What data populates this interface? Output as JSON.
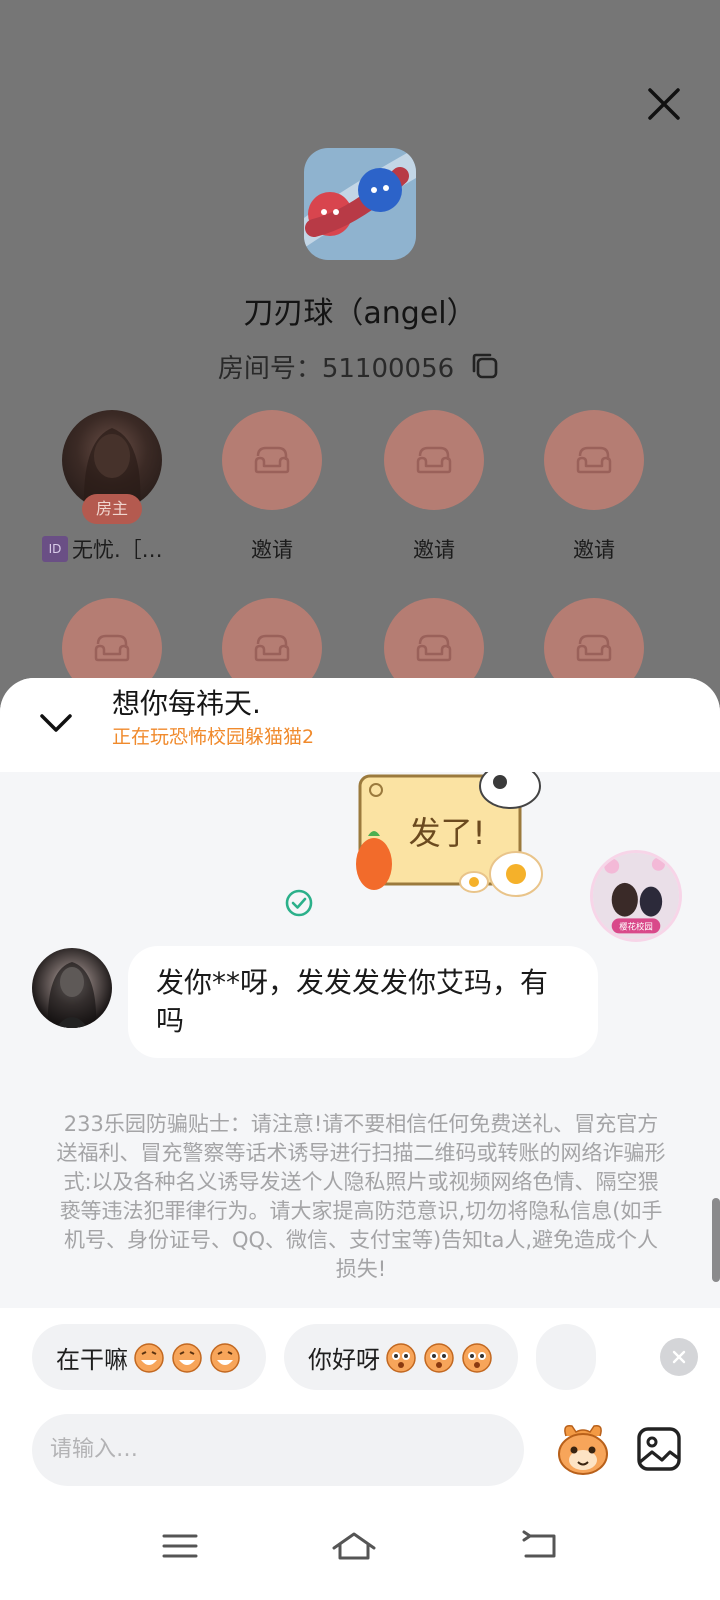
{
  "room": {
    "game_title": "刀刃球（angel）",
    "room_label": "房间号：51100056",
    "host": {
      "badge": "房主",
      "name_prefix": "ID",
      "name": "无忧.［…"
    },
    "invite_label": "邀请"
  },
  "chat": {
    "title": "想你每祎天.",
    "status": "正在玩恐怖校园躲猫猫2",
    "sticker_text": "发了!",
    "my_avatar_caption": "樱花校园",
    "message": "发你**呀，发发发发你艾玛，有吗",
    "tips": "233乐园防骗贴士：请注意!请不要相信任何免费送礼、冒充官方送福利、冒充警察等话术诱导进行扫描二维码或转账的网络诈骗形式:以及各种名义诱导发送个人隐私照片或视频网络色情、隔空猥亵等违法犯罪律行为。请大家提高防范意识,切勿将隐私信息(如手机号、身份证号、QQ、微信、支付宝等)告知ta人,避免造成个人损失!"
  },
  "quick_replies": [
    {
      "text": "在干嘛",
      "emoji": "laughing-face"
    },
    {
      "text": "你好呀",
      "emoji": "surprised-face"
    }
  ],
  "input": {
    "placeholder": "请输入…"
  },
  "colors": {
    "accent_orange": "#f08a2c",
    "seat_placeholder": "#b57d73",
    "read_check": "#2bb08a"
  }
}
